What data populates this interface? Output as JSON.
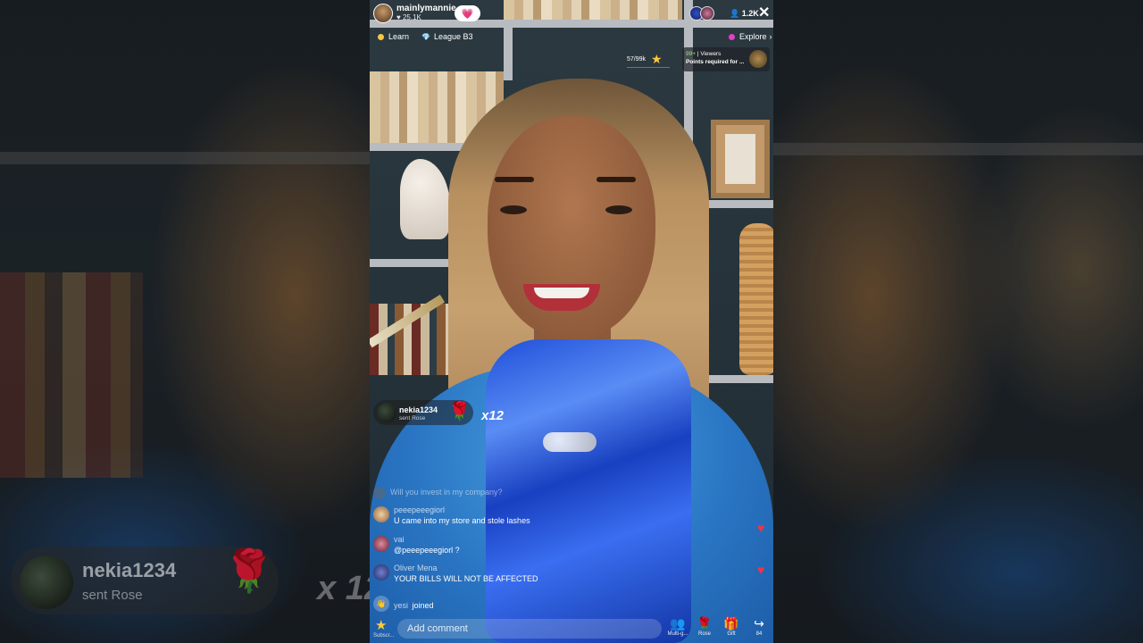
{
  "host": {
    "username": "mainlymannie",
    "likes": "25.1K"
  },
  "top_bar": {
    "viewer_count": "1.2K",
    "close_label": "✕"
  },
  "chips": {
    "learn": "Learn",
    "league": "League B3",
    "explore": "Explore"
  },
  "goal": {
    "progress_text": "57/99k"
  },
  "ranking": {
    "badge": "99+",
    "viewers_label": "Viewers",
    "points_text": "Points required for ..."
  },
  "gift": {
    "sender": "nekia1234",
    "action": "sent Rose",
    "count": "x12"
  },
  "chat": [
    {
      "user": "",
      "text": "Will you invest in my company?",
      "faded": true
    },
    {
      "user": "peeepeeegiorl",
      "text": "U came into my store and stole lashes"
    },
    {
      "user": "vai",
      "text": "@peeepeeegiorl ?"
    },
    {
      "user": "Oliver Mena",
      "text": "YOUR BILLS WILL NOT BE AFFECTED"
    },
    {
      "user": "yesi",
      "text": "joined"
    }
  ],
  "bottom": {
    "subscribe_label": "Subscr...",
    "comment_placeholder": "Add comment",
    "multi_label": "Multi-g...",
    "rose_label": "Rose",
    "gift_label": "Gift",
    "share_count": "84"
  },
  "colors": {
    "heart": "#f0334b",
    "star": "#ffc93a",
    "explore_dot": "#e040c8",
    "learn_dot": "#f5c842"
  }
}
